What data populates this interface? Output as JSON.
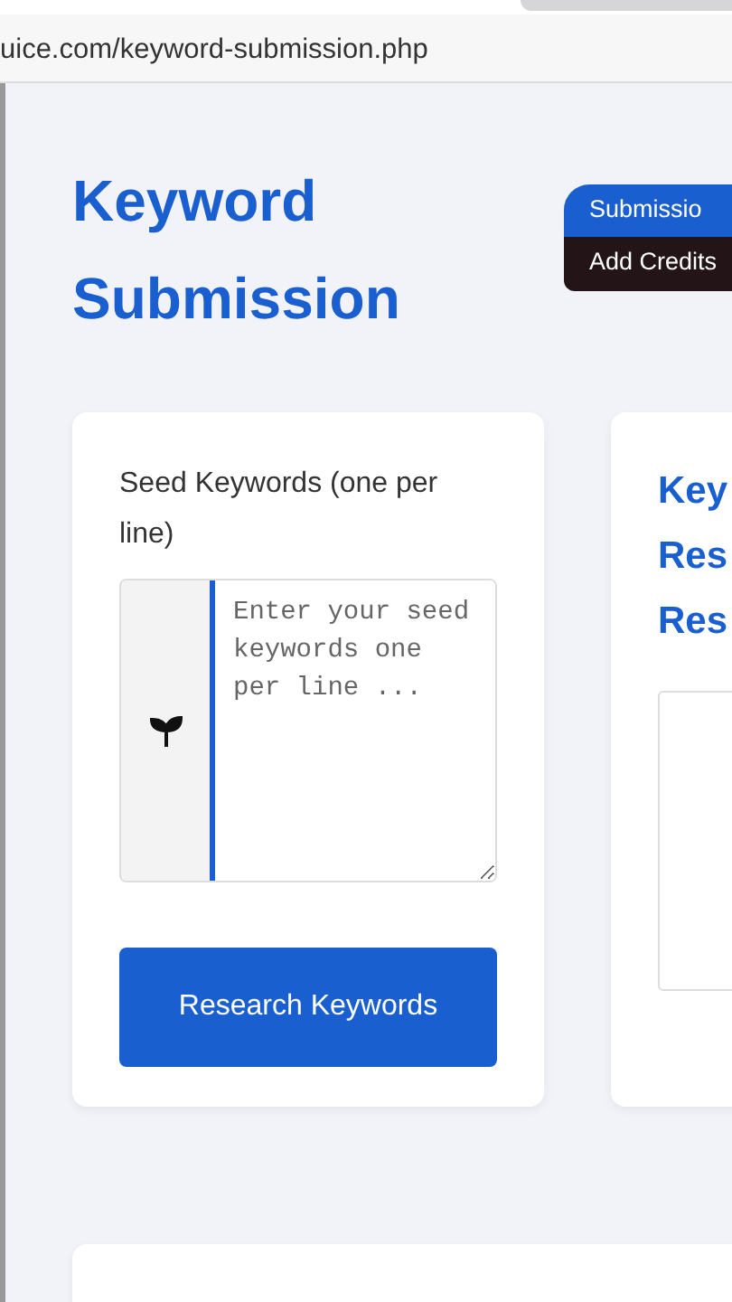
{
  "browser": {
    "url": "uice.com/keyword-submission.php"
  },
  "page": {
    "title_lines": [
      "Keyword",
      "Submission"
    ]
  },
  "header_buttons": [
    {
      "label": "Submissio",
      "kind": "primary"
    },
    {
      "label": "Add Credits",
      "kind": "dark"
    }
  ],
  "seed_card": {
    "label": "Seed Keywords (one per line)",
    "placeholder": "Enter your seed keywords one per line ...",
    "button": "Research Keywords"
  },
  "results_card": {
    "title_lines": [
      "Key",
      "Res",
      "Res"
    ]
  }
}
